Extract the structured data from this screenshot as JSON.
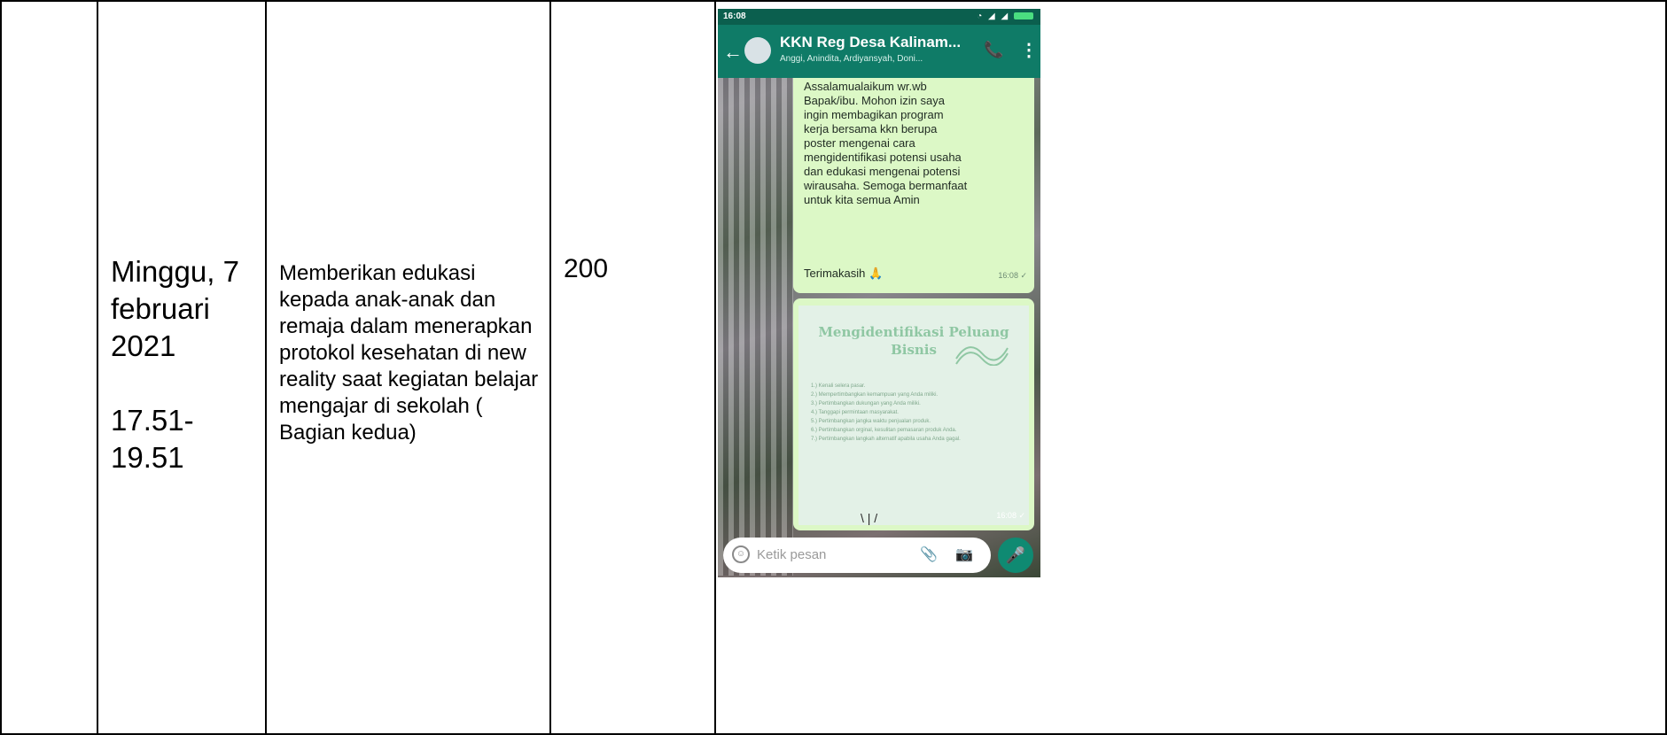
{
  "row": {
    "date_line1": "Minggu, 7",
    "date_line2": "februari",
    "date_line3": "2021",
    "time_line1": "17.51-",
    "time_line2": "19.51",
    "description": "Memberikan edukasi kepada anak-anak dan remaja dalam menerapkan protokol kesehatan di new reality saat kegiatan belajar mengajar di sekolah ( Bagian kedua)",
    "count": "200"
  },
  "phone": {
    "status_time": "16:08",
    "group_title": "KKN Reg Desa Kalinam...",
    "group_members": "Anggi, Anindita, Ardiyansyah, Doni...",
    "message_text": "Assalamualaikum wr.wb\nBapak/ibu. Mohon izin saya\ningin membagikan program\nkerja bersama kkn berupa\nposter mengenai cara\nmengidentifikasi potensi usaha\ndan edukasi mengenai potensi\nwirausaha. Semoga bermanfaat\nuntuk kita semua Amin",
    "message_thanks": "Terimakasih 🙏",
    "message_time": "16:08 ✓",
    "poster_title": "Mengidentifikasi Peluang Bisnis",
    "poster_items": "1.) Kenali selera pasar.\n2.) Mempertimbangkan kemampuan yang Anda miliki.\n3.) Pertimbangkan dukungan yang Anda miliki.\n4.) Tanggapi permintaan masyarakat.\n5.) Pertimbangkan jangka waktu penjualan produk.\n6.) Pertimbangkan orginal, kesulitan pemasaran produk Anda.\n7.) Pertimbangkan langkah alternatif apabila usaha Anda gagal.",
    "image_time": "16:08 ✓",
    "input_placeholder": "Ketik pesan"
  }
}
